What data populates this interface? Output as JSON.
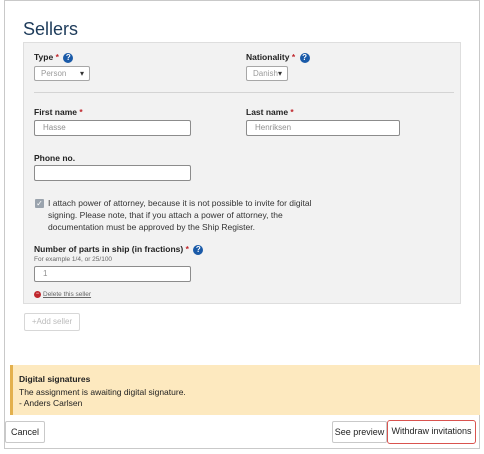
{
  "title": "Sellers",
  "form": {
    "type": {
      "label": "Type",
      "required": "*",
      "value": "Person"
    },
    "nationality": {
      "label": "Nationality",
      "required": "*",
      "value": "Danish"
    },
    "first_name": {
      "label": "First name",
      "required": "*",
      "value": "Hasse"
    },
    "last_name": {
      "label": "Last name",
      "required": "*",
      "value": "Henriksen"
    },
    "phone": {
      "label": "Phone no.",
      "value": ""
    },
    "power_of_attorney": {
      "checked": true,
      "line1": "I attach power of attorney, because it is not possible to invite for digital",
      "line2": "signing. Please note, that if you attach a power of attorney, the",
      "line3": "documentation must be approved by the Ship Register."
    },
    "parts": {
      "label": "Number of parts in ship (in fractions)",
      "required": "*",
      "hint": "For example 1/4, or 25/100",
      "value": "1"
    },
    "delete_label": "Delete this seller"
  },
  "add_seller_label": "+Add seller",
  "alert": {
    "heading": "Digital signatures",
    "text": "The assignment is awaiting digital signature.",
    "signer": "- Anders Carlsen"
  },
  "buttons": {
    "cancel": "Cancel",
    "preview": "See preview",
    "withdraw": "Withdraw invitations"
  },
  "colors": {
    "accent": "#1a5aa8",
    "warning_bg": "#fde9bf",
    "highlight": "#d9534f"
  }
}
